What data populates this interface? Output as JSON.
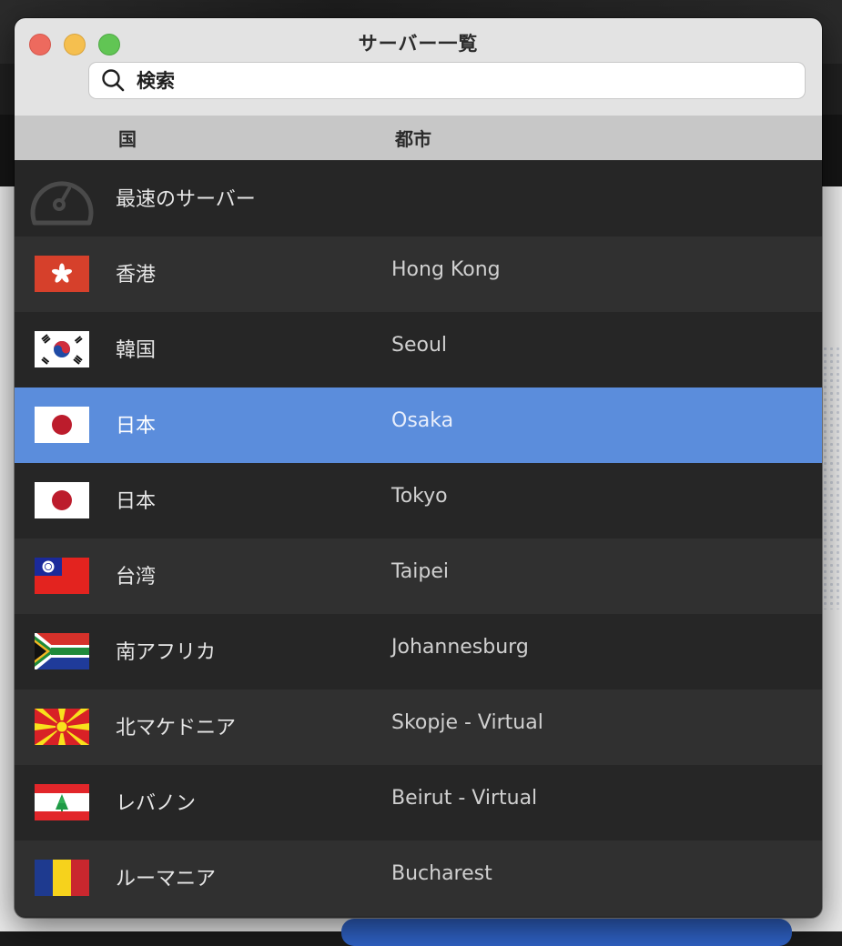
{
  "window": {
    "title": "サーバー一覧"
  },
  "search": {
    "placeholder": "検索",
    "value": ""
  },
  "columns": {
    "country": "国",
    "city": "都市"
  },
  "servers": [
    {
      "country": "最速のサーバー",
      "city": "",
      "icon": "gauge-icon"
    },
    {
      "country": "香港",
      "city": "Hong Kong",
      "flag": "hong-kong-flag-icon"
    },
    {
      "country": "韓国",
      "city": "Seoul",
      "flag": "south-korea-flag-icon"
    },
    {
      "country": "日本",
      "city": "Osaka",
      "flag": "japan-flag-icon",
      "selected": true
    },
    {
      "country": "日本",
      "city": "Tokyo",
      "flag": "japan-flag-icon"
    },
    {
      "country": "台湾",
      "city": "Taipei",
      "flag": "taiwan-flag-icon"
    },
    {
      "country": "南アフリカ",
      "city": "Johannesburg",
      "flag": "south-africa-flag-icon"
    },
    {
      "country": "北マケドニア",
      "city": "Skopje - Virtual",
      "flag": "north-macedonia-flag-icon"
    },
    {
      "country": "レバノン",
      "city": "Beirut - Virtual",
      "flag": "lebanon-flag-icon"
    },
    {
      "country": "ルーマニア",
      "city": "Bucharest",
      "flag": "romania-flag-icon"
    }
  ],
  "colors": {
    "selection": "#5b8ddc",
    "row_dark": "#262626",
    "row_light": "#303030",
    "header": "#c7c7c7"
  }
}
